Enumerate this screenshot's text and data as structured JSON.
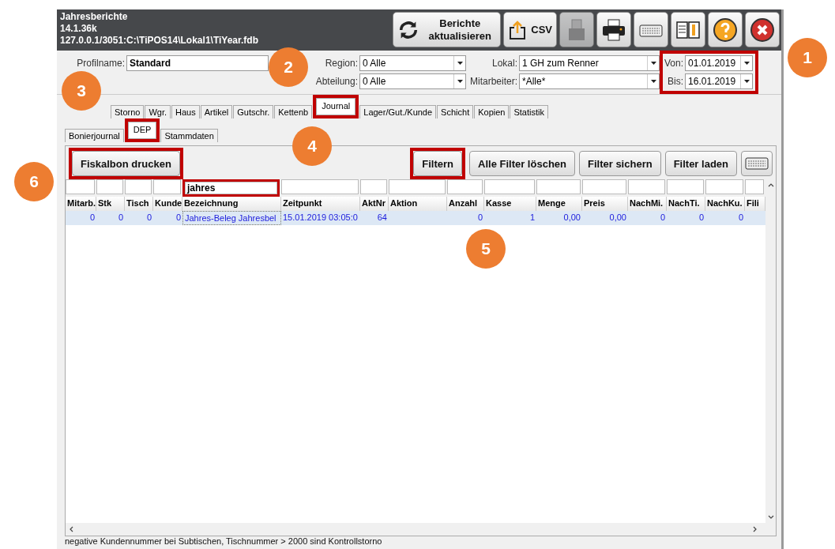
{
  "window": {
    "title_lines": [
      "Jahresberichte",
      "14.1.36k",
      "127.0.0.1/3051:C:\\TiPOS14\\Lokal1\\TiYear.fdb"
    ]
  },
  "toolbar": [
    {
      "kind": "refresh",
      "label": "Berichte aktualisieren",
      "disabled": false
    },
    {
      "kind": "csv",
      "label": "CSV",
      "disabled": false
    },
    {
      "kind": "receipt-printer",
      "disabled": true
    },
    {
      "kind": "printer",
      "disabled": false
    },
    {
      "kind": "keyboard",
      "disabled": false
    },
    {
      "kind": "manual",
      "disabled": false
    },
    {
      "kind": "help",
      "disabled": false
    },
    {
      "kind": "close",
      "disabled": false
    }
  ],
  "filters": {
    "profile": {
      "label": "Profilname:",
      "value": "Standard"
    },
    "region": {
      "label": "Region:",
      "value": "0 Alle"
    },
    "department": {
      "label": "Abteilung:",
      "value": "0 Alle"
    },
    "location": {
      "label": "Lokal:",
      "value": "1 GH zum Renner"
    },
    "employee": {
      "label": "Mitarbeiter:",
      "value": "*Alle*"
    },
    "from": {
      "label": "Von:",
      "value": "01.01.2019"
    },
    "to": {
      "label": "Bis:",
      "value": "16.01.2019"
    },
    "date_range_highlighted": true
  },
  "tabs": [
    {
      "label": "Storno",
      "selected": false,
      "highlighted": false
    },
    {
      "label": "Wgr.",
      "selected": false,
      "highlighted": false
    },
    {
      "label": "Haus",
      "selected": false,
      "highlighted": false
    },
    {
      "label": "Artikel",
      "selected": false,
      "highlighted": false
    },
    {
      "label": "Gutschr.",
      "selected": false,
      "highlighted": false
    },
    {
      "label": "Kettenb",
      "selected": false,
      "highlighted": false
    },
    {
      "label": "Journal",
      "selected": true,
      "highlighted": true
    },
    {
      "label": "Lager/Gut./Kunde",
      "selected": false,
      "highlighted": false
    },
    {
      "label": "Schicht",
      "selected": false,
      "highlighted": false
    },
    {
      "label": "Kopien",
      "selected": false,
      "highlighted": false
    },
    {
      "label": "Statistik",
      "selected": false,
      "highlighted": false
    }
  ],
  "subtabs": [
    {
      "label": "Bonierjournal",
      "selected": false,
      "highlighted": false
    },
    {
      "label": "DEP",
      "selected": true,
      "highlighted": true
    },
    {
      "label": "Stammdaten",
      "selected": false,
      "highlighted": false
    }
  ],
  "actions": {
    "print": {
      "label": "Fiskalbon drucken",
      "highlighted": true
    },
    "buttons": [
      {
        "label": "Filtern",
        "highlighted": true
      },
      {
        "label": "Alle Filter löschen",
        "highlighted": false
      },
      {
        "label": "Filter sichern",
        "highlighted": false
      },
      {
        "label": "Filter laden",
        "highlighted": false
      }
    ]
  },
  "table": {
    "columns": [
      {
        "label": "Mitarb."
      },
      {
        "label": "Stk"
      },
      {
        "label": "Tisch"
      },
      {
        "label": "Kunde"
      },
      {
        "label": "Bezeichnung",
        "filter": "jahres",
        "highlighted": true
      },
      {
        "label": "Zeitpunkt"
      },
      {
        "label": "AktNr"
      },
      {
        "label": "Aktion"
      },
      {
        "label": "Anzahl"
      },
      {
        "label": "Kasse"
      },
      {
        "label": "Menge"
      },
      {
        "label": "Preis"
      },
      {
        "label": "NachMi."
      },
      {
        "label": "NachTi."
      },
      {
        "label": "NachKu."
      },
      {
        "label": "Fili"
      }
    ],
    "rows": [
      {
        "selected": true,
        "cells": [
          "0",
          "0",
          "0",
          "0",
          "Jahres-Beleg  Jahresbel",
          "15.01.2019 03:05:0",
          "64",
          null,
          "0",
          "1",
          "0,00",
          "0,00",
          "0",
          "0",
          "0",
          null
        ]
      }
    ]
  },
  "status_bar": "negative Kundennummer bei Subtischen, Tischnummer > 2000 sind Kontrollstorno",
  "annotations": [
    "1",
    "2",
    "3",
    "4",
    "5",
    "6"
  ]
}
